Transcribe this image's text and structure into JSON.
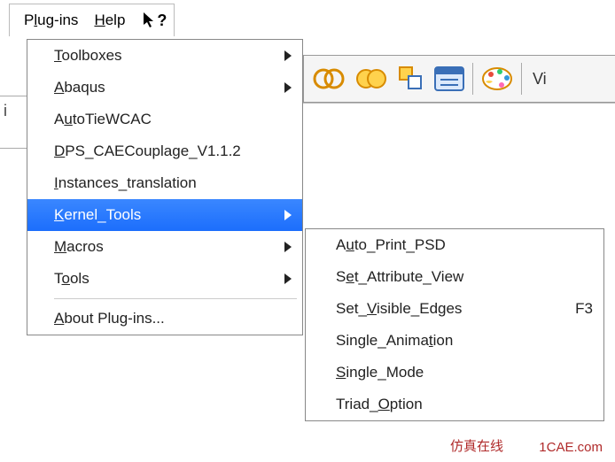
{
  "menubar": {
    "plugins": {
      "pre": "P",
      "u": "l",
      "post": "ug-ins"
    },
    "help": {
      "pre": "",
      "u": "H",
      "post": "elp"
    }
  },
  "sub_area_label": "i",
  "toolbar": {
    "vi_label": "Vi"
  },
  "primary_menu": {
    "items": [
      {
        "pre": "",
        "u": "T",
        "post": "oolboxes",
        "submenu": true,
        "hl": false,
        "sep_after": false
      },
      {
        "pre": "",
        "u": "A",
        "post": "baqus",
        "submenu": true,
        "hl": false,
        "sep_after": false
      },
      {
        "pre": "A",
        "u": "u",
        "post": "toTieWCAC",
        "submenu": false,
        "hl": false,
        "sep_after": false
      },
      {
        "pre": "",
        "u": "D",
        "post": "PS_CAECouplage_V1.1.2",
        "submenu": false,
        "hl": false,
        "sep_after": false
      },
      {
        "pre": "",
        "u": "I",
        "post": "nstances_translation",
        "submenu": false,
        "hl": false,
        "sep_after": false
      },
      {
        "pre": "",
        "u": "K",
        "post": "ernel_Tools",
        "submenu": true,
        "hl": true,
        "sep_after": false
      },
      {
        "pre": "",
        "u": "M",
        "post": "acros",
        "submenu": true,
        "hl": false,
        "sep_after": false
      },
      {
        "pre": "T",
        "u": "o",
        "post": "ols",
        "submenu": true,
        "hl": false,
        "sep_after": true
      },
      {
        "pre": "",
        "u": "A",
        "post": "bout Plug-ins...",
        "submenu": false,
        "hl": false,
        "sep_after": false
      }
    ]
  },
  "secondary_menu": {
    "items": [
      {
        "pre": "A",
        "u": "u",
        "post": "to_Print_PSD",
        "accel": ""
      },
      {
        "pre": "S",
        "u": "e",
        "post": "t_Attribute_View",
        "accel": ""
      },
      {
        "pre": "Set_",
        "u": "V",
        "post": "isible_Edges",
        "accel": "F3"
      },
      {
        "pre": "Single_Anima",
        "u": "t",
        "post": "ion",
        "accel": ""
      },
      {
        "pre": "",
        "u": "S",
        "post": "ingle_Mode",
        "accel": ""
      },
      {
        "pre": "Triad_",
        "u": "O",
        "post": "ption",
        "accel": ""
      }
    ]
  },
  "watermarks": {
    "site": "1CAE.com",
    "other": "仿真在线"
  }
}
